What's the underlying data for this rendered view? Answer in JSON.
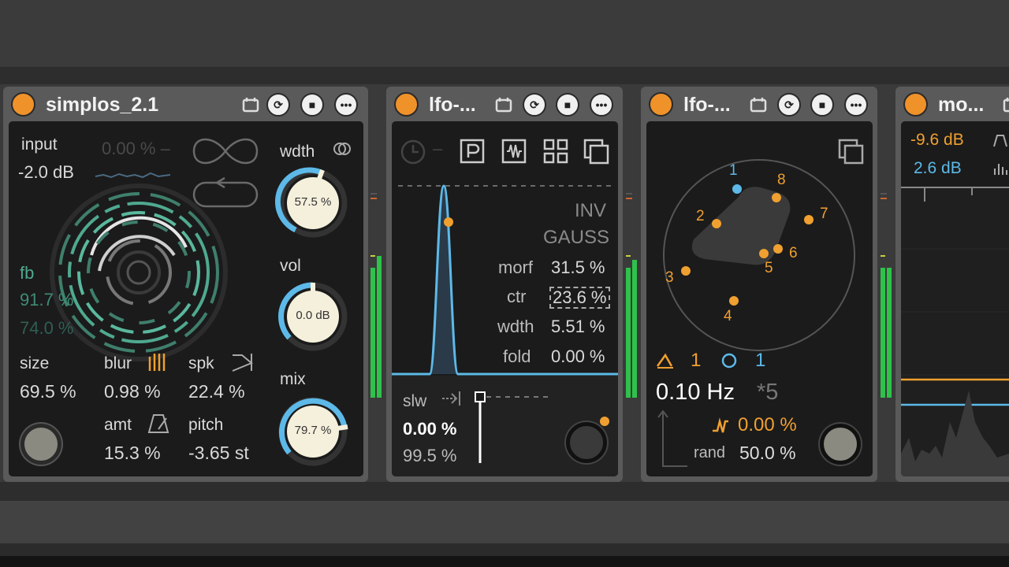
{
  "colors": {
    "accent": "#f0922a",
    "blue": "#5db9e8",
    "green": "#2ec24a",
    "teal": "#4fa98f",
    "panel": "#1b1b1b"
  },
  "device1": {
    "title": "simplos_2.1",
    "input_label": "input",
    "input_value": "-2.0 dB",
    "pct_top": "0.00 % –",
    "wdth_label": "wdth",
    "wdth_value": "57.5 %",
    "vol_label": "vol",
    "vol_value": "0.0 dB",
    "mix_label": "mix",
    "mix_value": "79.7 %",
    "fb_label": "fb",
    "fb_value1": "91.7 %",
    "fb_value2": "74.0 %",
    "size_label": "size",
    "size_value": "69.5 %",
    "blur_label": "blur",
    "blur_value": "0.98 %",
    "spk_label": "spk",
    "spk_value": "22.4 %",
    "amt_label": "amt",
    "amt_value": "15.3 %",
    "pitch_label": "pitch",
    "pitch_value": "-3.65 st"
  },
  "device2": {
    "title": "lfo-...",
    "inv": "INV",
    "gauss": "GAUSS",
    "morf_label": "morf",
    "morf_value": "31.5 %",
    "ctr_label": "ctr",
    "ctr_value": "23.6 %",
    "wdth_label": "wdth",
    "wdth_value": "5.51 %",
    "fold_label": "fold",
    "fold_value": "0.00 %",
    "slw_label": "slw",
    "slw_value": "0.00 %",
    "slw_value2": "99.5 %"
  },
  "device3": {
    "title": "lfo-...",
    "points": [
      "1",
      "2",
      "3",
      "4",
      "5",
      "6",
      "7",
      "8"
    ],
    "tri_count": "1",
    "circ_count": "1",
    "rate": "0.10 Hz",
    "mult": "*5",
    "wave_value": "0.00 %",
    "rand_label": "rand",
    "rand_value": "50.0 %"
  },
  "device4": {
    "title": "mo...",
    "db1": "-9.6 dB",
    "db2": "2.6 dB"
  },
  "icons": [
    "clock-icon",
    "p-icon",
    "waveform-icon",
    "grid-icon",
    "copy-icon",
    "infinity-icon",
    "loop-icon",
    "calendar-icon",
    "refresh-icon",
    "save-icon",
    "more-icon"
  ]
}
